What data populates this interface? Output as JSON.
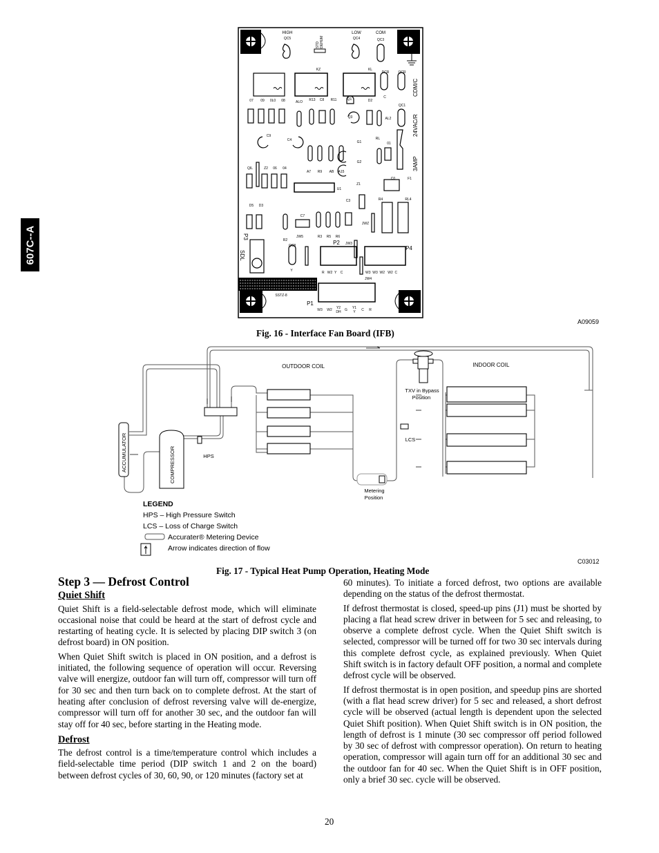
{
  "side_tab": "607C--A",
  "fig16": {
    "caption": "Fig. 16 - Interface Fan Board (IFB)",
    "code": "A09059",
    "labels": {
      "high": "HIGH",
      "qc5": "QC5",
      "std": "STD",
      "dehum": "DEHUM",
      "low": "LOW",
      "qc4": "QC4",
      "com": "COM",
      "qc3": "QC3",
      "kz": "KZ",
      "kl": "KL",
      "dcr": "DCR",
      "qcr": "QCR",
      "cdmc": "CDM/C",
      "c": "C",
      "l07": "07",
      "l09": "09",
      "l0l0": "0L0",
      "l08": "08",
      "alo": "ALO",
      "r13": "R13",
      "c8": "C8",
      "r11": "R11",
      "q1": "Q1",
      "d2": "D2",
      "qc1": "QC1",
      "vac": "24VAC/R",
      "q3": "Q3",
      "al2": "AL2",
      "c9": "C9",
      "c4": "C4",
      "g1": "G1",
      "rl": "RL",
      "l01": "01",
      "amp": "3AMP",
      "qil": "QIL",
      "z2": "Z2",
      "l06": "06",
      "l04": "04",
      "a7": "A7",
      "r9": "R9",
      "ab": "AB",
      "a15": "A15",
      "g2": "G2",
      "z1": "Z1",
      "c0": "C0",
      "f1": "F1",
      "u1": "U1",
      "c3": "C3",
      "r4": "R4",
      "rl4": "RL4",
      "d5": "D5",
      "d3": "D3",
      "c7": "C7",
      "jw5": "JW5",
      "r2": "R2",
      "r3": "R3",
      "r5": "R5",
      "r6": "R6",
      "jwz": "JWZ",
      "p3": "P3",
      "sdl": "SDL",
      "qc8": "QC8",
      "p2": "P2",
      "jw3": "JW3",
      "p4": "P4",
      "y": "Y",
      "p2pins": "R   W2  Y    C",
      "p4pins": "W3  W3  W2   W2  C",
      "jw4": "JW4",
      "sstz": "SSTZ-8",
      "p1": "P1",
      "p1_w3": "W3",
      "p1_w2": "W2",
      "p1_y2": "Y2",
      "p1_dh": "DH",
      "p1_g": "G",
      "p1_y1": "Y1",
      "p1_y": "Y",
      "p1_c": "C",
      "p1_r": "R"
    }
  },
  "fig17": {
    "caption": "Fig. 17 - Typical Heat Pump Operation, Heating Mode",
    "code": "C03012",
    "outdoor_coil": "OUTDOOR COIL",
    "indoor_coil": "INDOOR COIL",
    "accumulator": "ACCUMULATOR",
    "compressor": "COMPRESSOR",
    "hps": "HPS",
    "lcs": "LCS",
    "txv_1": "TXV in Bypass",
    "txv_2": "Position",
    "metering_1": "Metering",
    "metering_2": "Position",
    "legend": {
      "title": "LEGEND",
      "hps": "HPS – High Pressure Switch",
      "lcs": "LCS – Loss of Charge Switch",
      "accurater": "Accurater® Metering Device",
      "arrow": "Arrow indicates direction of flow"
    }
  },
  "text": {
    "step_title": "Step 3 — Defrost Control",
    "quiet_shift_heading": "Quiet Shift",
    "qs_p1": "Quiet Shift is a field‑selectable defrost mode, which will eliminate occasional noise that could be heard at the start of defrost cycle and restarting of heating cycle. It is selected by placing DIP switch 3 (on defrost board) in ON position.",
    "qs_p2": "When Quiet Shift switch is placed in ON position, and a defrost is initiated, the following sequence of operation will occur. Reversing valve will energize, outdoor fan will turn off, compressor will turn off for 30 sec and then turn back on to complete defrost. At the start of heating after conclusion of defrost reversing valve will de‑energize, compressor will turn off for another 30 sec, and the outdoor fan will stay off for 40 sec, before starting in the Heating mode.",
    "defrost_heading": "Defrost",
    "df_p1": "The defrost control is a time/temperature control which includes a field‑selectable time period (DIP switch 1 and 2 on the board) between defrost cycles of 30, 60, 90, or 120 minutes (factory set at 60 minutes). To initiate a forced defrost, two options are available depending on the status of the defrost thermostat.",
    "df_p2": "If defrost thermostat is closed, speed‑up pins (J1) must be shorted by placing a flat head screw driver in between for 5 sec and releasing, to observe a complete defrost cycle. When the Quiet Shift switch is selected, compressor will be turned off for two 30 sec intervals during this complete defrost cycle, as explained previously. When Quiet Shift switch is in factory default OFF position, a normal and complete defrost cycle will be observed.",
    "df_p3": "If defrost thermostat is in open position, and speedup pins are shorted (with a flat head screw driver) for 5 sec and released, a short defrost cycle will be observed (actual length is dependent upon the selected Quiet Shift position). When Quiet Shift switch is in ON position, the length of defrost is 1 minute (30 sec compressor off period followed by 30 sec of defrost with compressor operation). On return to heating operation, compressor will again turn off for an additional 30 sec and the outdoor fan for 40 sec. When the Quiet Shift is in OFF position, only a brief 30 sec. cycle will be observed."
  },
  "page_number": "20"
}
